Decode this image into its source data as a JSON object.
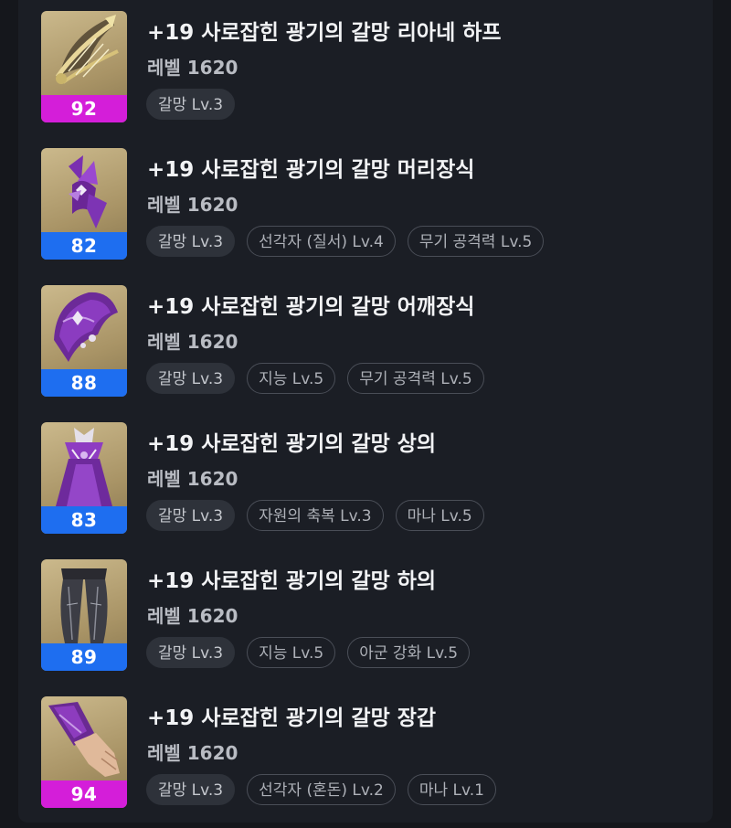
{
  "items": [
    {
      "name": "+19 사로잡힌 광기의 갈망 리아네 하프",
      "level": "레벨 1620",
      "quality": "92",
      "quality_color": "#d41ed9",
      "icon": "harp-icon",
      "tags": [
        "갈망 Lv.3"
      ]
    },
    {
      "name": "+19 사로잡힌 광기의 갈망 머리장식",
      "level": "레벨 1620",
      "quality": "82",
      "quality_color": "#1e6ef0",
      "icon": "headpiece-icon",
      "tags": [
        "갈망 Lv.3",
        "선각자 (질서) Lv.4",
        "무기 공격력 Lv.5"
      ]
    },
    {
      "name": "+19 사로잡힌 광기의 갈망 어깨장식",
      "level": "레벨 1620",
      "quality": "88",
      "quality_color": "#1e6ef0",
      "icon": "shoulder-icon",
      "tags": [
        "갈망 Lv.3",
        "지능 Lv.5",
        "무기 공격력 Lv.5"
      ]
    },
    {
      "name": "+19 사로잡힌 광기의 갈망 상의",
      "level": "레벨 1620",
      "quality": "83",
      "quality_color": "#1e6ef0",
      "icon": "chest-armor-icon",
      "tags": [
        "갈망 Lv.3",
        "자원의 축복 Lv.3",
        "마나 Lv.5"
      ]
    },
    {
      "name": "+19 사로잡힌 광기의 갈망 하의",
      "level": "레벨 1620",
      "quality": "89",
      "quality_color": "#1e6ef0",
      "icon": "pants-icon",
      "tags": [
        "갈망 Lv.3",
        "지능 Lv.5",
        "아군 강화 Lv.5"
      ]
    },
    {
      "name": "+19 사로잡힌 광기의 갈망 장갑",
      "level": "레벨 1620",
      "quality": "94",
      "quality_color": "#d41ed9",
      "icon": "gloves-icon",
      "tags": [
        "갈망 Lv.3",
        "선각자 (혼돈) Lv.2",
        "마나 Lv.1"
      ]
    }
  ]
}
